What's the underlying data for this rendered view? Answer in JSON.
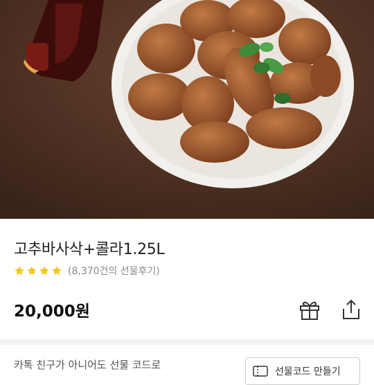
{
  "product": {
    "title": "고추바사삭+콜라1.25L",
    "rating_stars": 4,
    "review_text": "(8,370건의 선물후기)",
    "price": "20,000원"
  },
  "actions": {
    "gift_icon": "gift-icon",
    "share_icon": "share-icon"
  },
  "promo": {
    "text": "카톡 친구가 아니어도 선물 코드로",
    "code_button_label": "선물코드 만들기"
  },
  "colors": {
    "star": "#f5c518",
    "hero_bg": "#4b2f21"
  }
}
